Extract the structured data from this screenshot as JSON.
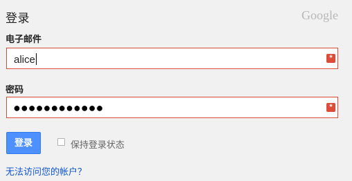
{
  "header": {
    "title": "登录",
    "logo": "Google"
  },
  "form": {
    "email_label": "电子邮件",
    "email_value": "alice",
    "password_label": "密码",
    "password_value": "●●●●●●●●●●●●",
    "error_icon": "*"
  },
  "actions": {
    "signin_label": "登录",
    "remember_label": "保持登录状态",
    "help_link": "无法访问您的帐户？"
  },
  "colors": {
    "accent": "#4d90fe",
    "error": "#dd4b39",
    "link": "#1155cc",
    "background": "#f1f1f1"
  },
  "icons": {
    "error": "asterisk-icon",
    "checkbox": "checkbox-empty"
  }
}
